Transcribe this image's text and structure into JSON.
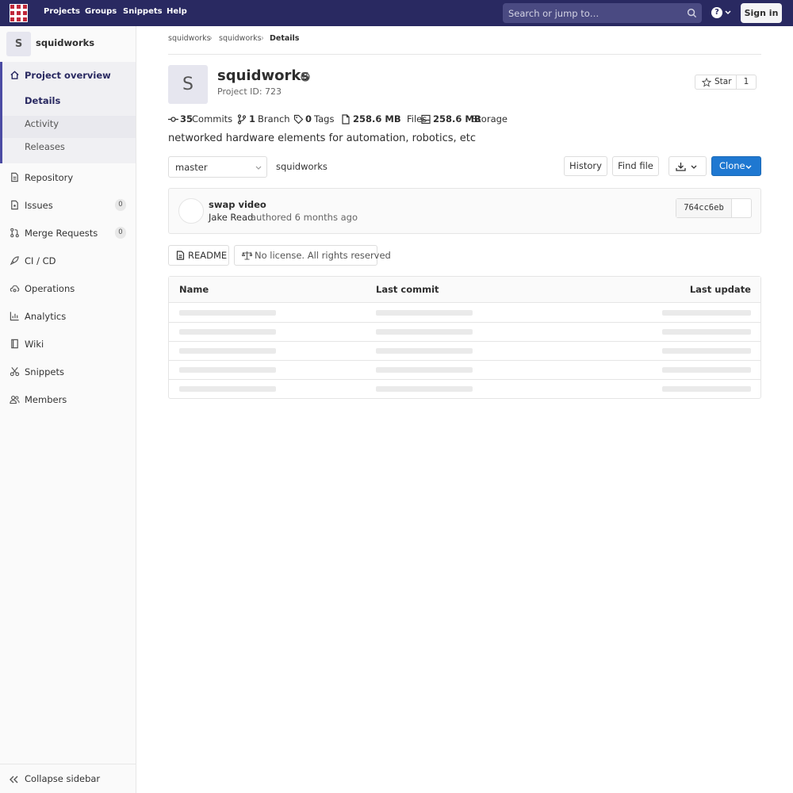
{
  "topnav": {
    "links": [
      "Projects",
      "Groups",
      "Snippets",
      "Help"
    ],
    "search_placeholder": "Search or jump to…",
    "signin_label": "Sign in"
  },
  "sidebar": {
    "project_avatar_letter": "S",
    "project_name": "squidworks",
    "overview_label": "Project overview",
    "overview_subitems": [
      "Details",
      "Activity",
      "Releases"
    ],
    "items": [
      {
        "label": "Repository",
        "icon": "doc-icon"
      },
      {
        "label": "Issues",
        "icon": "issues-icon",
        "count": "0"
      },
      {
        "label": "Merge Requests",
        "icon": "merge-request-icon",
        "count": "0"
      },
      {
        "label": "CI / CD",
        "icon": "rocket-icon"
      },
      {
        "label": "Operations",
        "icon": "cloud-gear-icon"
      },
      {
        "label": "Analytics",
        "icon": "chart-icon"
      },
      {
        "label": "Wiki",
        "icon": "book-icon"
      },
      {
        "label": "Snippets",
        "icon": "scissors-icon"
      },
      {
        "label": "Members",
        "icon": "users-icon"
      }
    ],
    "collapse_label": "Collapse sidebar"
  },
  "breadcrumb": [
    "squidworks",
    "squidworks",
    "Details"
  ],
  "project": {
    "avatar_letter": "S",
    "title": "squidworks",
    "id_text": "Project ID: 723",
    "star_label": "Star",
    "star_count": "1",
    "description": "networked hardware elements for automation, robotics, etc"
  },
  "stats": {
    "commits": {
      "num": "35",
      "unit": "Commits"
    },
    "branch": {
      "num": "1",
      "unit": "Branch"
    },
    "tags": {
      "num": "0",
      "unit": "Tags"
    },
    "files": {
      "num": "258.6 MB",
      "unit": "Files"
    },
    "storage": {
      "num": "258.6 MB",
      "unit": "Storage"
    }
  },
  "repo": {
    "branch": "master",
    "path": "squidworks",
    "history_label": "History",
    "find_file_label": "Find file",
    "clone_label": "Clone"
  },
  "commit": {
    "message": "swap video",
    "author": "Jake Read",
    "rest": "authored 6 months ago",
    "sha": "764cc6eb"
  },
  "pills": {
    "readme": "README",
    "license": "No license. All rights reserved"
  },
  "table": {
    "headers": [
      "Name",
      "Last commit",
      "Last update"
    ],
    "loading_rows": 5
  },
  "colors": {
    "navbar": "#292961",
    "accent": "#4b4ba3",
    "clone_button": "#1f78d1"
  }
}
